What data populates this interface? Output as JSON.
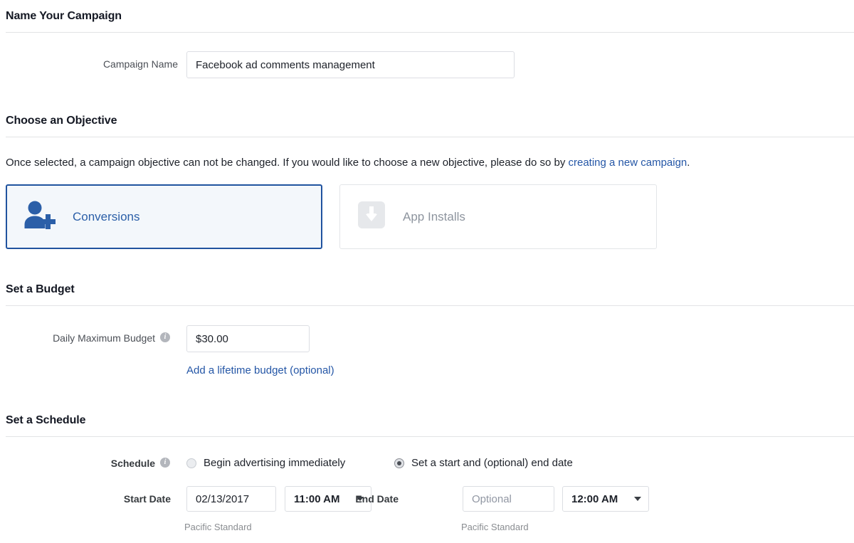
{
  "sections": {
    "name": {
      "heading": "Name Your Campaign"
    },
    "objective": {
      "heading": "Choose an Objective",
      "description_before": "Once selected, a campaign objective can not be changed. If you would like to choose a new objective, please do so by ",
      "link_text": "creating a new campaign",
      "description_after": ".",
      "options": [
        {
          "label": "Conversions",
          "icon": "person-plus-icon",
          "selected": true
        },
        {
          "label": "App Installs",
          "icon": "app-download-icon",
          "selected": false
        }
      ]
    },
    "budget": {
      "heading": "Set a Budget"
    },
    "schedule": {
      "heading": "Set a Schedule"
    }
  },
  "campaign_name": {
    "label": "Campaign Name",
    "value": "Facebook ad comments management",
    "placeholder": ""
  },
  "daily_budget": {
    "label": "Daily Maximum Budget",
    "value": "$30.00",
    "placeholder": "",
    "info_glyph": "i",
    "lifetime_link": "Add a lifetime budget (optional)"
  },
  "schedule": {
    "label": "Schedule",
    "info_glyph": "i",
    "radios": [
      {
        "label": "Begin advertising immediately",
        "selected": false
      },
      {
        "label": "Set a start and (optional) end date",
        "selected": true
      }
    ],
    "start": {
      "label": "Start Date",
      "date_value": "02/13/2017",
      "date_placeholder": "",
      "time_value": "11:00 AM",
      "timezone": "Pacific Standard"
    },
    "end": {
      "label": "End Date",
      "date_value": "",
      "date_placeholder": "Optional",
      "time_value": "12:00 AM",
      "timezone": "Pacific Standard"
    }
  },
  "colors": {
    "accent_blue": "#2456a6",
    "selected_border": "#20539f",
    "selected_fill": "#f3f7fb",
    "muted_gray": "#8d949e"
  }
}
